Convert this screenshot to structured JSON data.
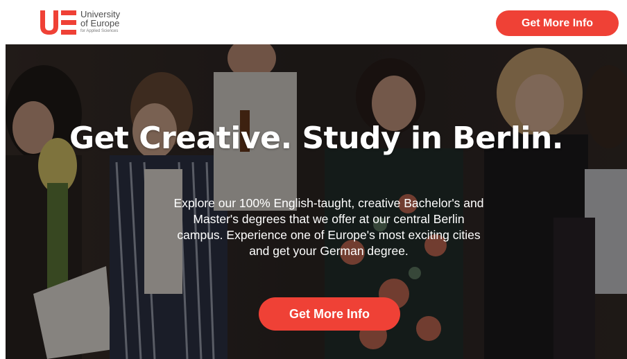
{
  "brand": {
    "mark": "UE",
    "name_line1": "University",
    "name_line2": "of Europe",
    "name_line3": "for Applied Sciences",
    "color": "#ef4136"
  },
  "header": {
    "cta_label": "Get More Info"
  },
  "hero": {
    "title": "Get Creative. Study in Berlin.",
    "body_lines": [
      "Explore our 100% English-taught, creative Bachelor's and",
      "Master's degrees that we offer at our central Berlin",
      "campus. Experience one of Europe's most exciting cities",
      "and get your German degree."
    ],
    "cta_label": "Get More Info"
  },
  "colors": {
    "accent": "#ef4136",
    "text_on_hero": "#ffffff"
  }
}
